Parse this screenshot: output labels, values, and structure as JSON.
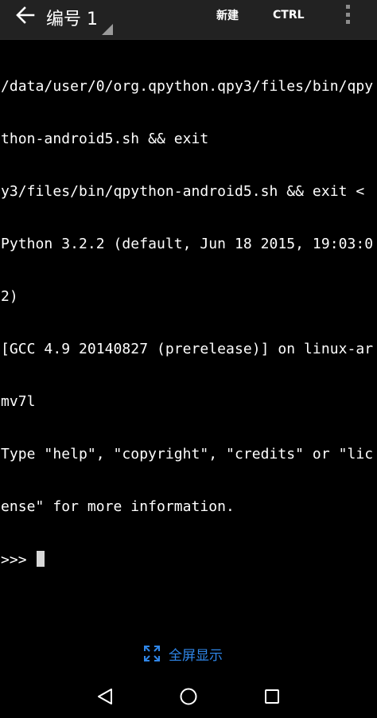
{
  "appbar": {
    "title": "编号 1",
    "new_label": "新建",
    "ctrl_label": "CTRL",
    "icons": {
      "back": "arrow-left-icon",
      "overflow": "more-vert-icon"
    }
  },
  "terminal": {
    "lines": [
      "/data/user/0/org.qpython.qpy3/files/bin/qpy",
      "thon-android5.sh && exit",
      "y3/files/bin/qpython-android5.sh && exit <",
      "Python 3.2.2 (default, Jun 18 2015, 19:03:0",
      "2)",
      "[GCC 4.9 20140827 (prerelease)] on linux-ar",
      "mv7l",
      "Type \"help\", \"copyright\", \"credits\" or \"lic",
      "ense\" for more information."
    ],
    "prompt": ">>> "
  },
  "fullscreen": {
    "label": "全屏显示",
    "icon": "fullscreen-icon"
  },
  "navbar": {
    "icons": [
      "nav-back-icon",
      "nav-home-icon",
      "nav-recents-icon"
    ]
  },
  "colors": {
    "accent": "#2f86e8",
    "appbar_bg": "#222222",
    "terminal_bg": "#000000",
    "text": "#ffffff"
  }
}
